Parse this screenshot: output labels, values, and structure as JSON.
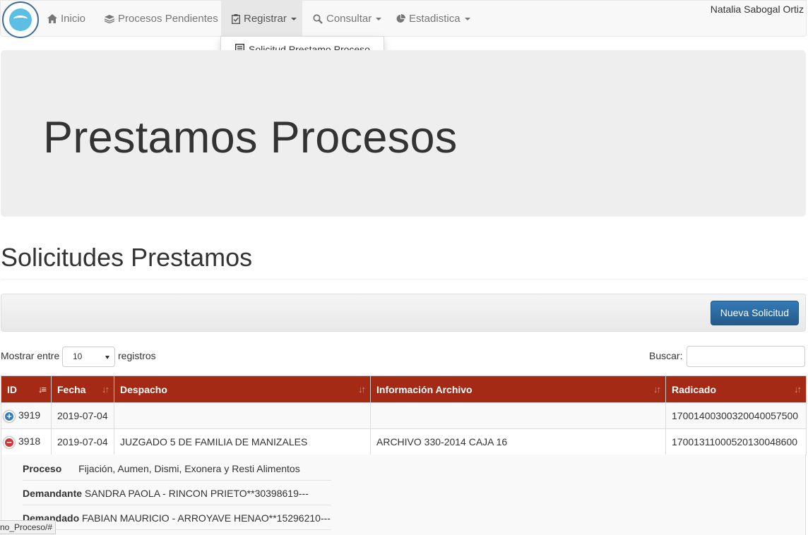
{
  "nav": {
    "items": [
      {
        "label": "Inicio",
        "icon": "home-icon"
      },
      {
        "label": "Procesos Pendientes",
        "icon": "layers-icon"
      },
      {
        "label": "Registrar",
        "icon": "clipboard-check-icon"
      },
      {
        "label": "Consultar",
        "icon": "search-icon"
      },
      {
        "label": "Estadistica",
        "icon": "pie-chart-icon"
      }
    ],
    "user": "Natalia Sabogal Ortiz"
  },
  "dropdown": {
    "items": [
      {
        "label": "Solicitud Prestamo Proceso",
        "icon": "list-alt-icon"
      }
    ]
  },
  "jumbotron": {
    "title": "Prestamos Procesos"
  },
  "section": {
    "title": "Solicitudes Prestamos"
  },
  "panel": {
    "new_button": "Nueva Solicitud"
  },
  "controls": {
    "show_before": "Mostrar entre",
    "show_value": "10",
    "show_after": "registros",
    "search_label": "Buscar:",
    "search_value": ""
  },
  "table": {
    "columns": [
      "ID",
      "Fecha",
      "Despacho",
      "Información Archivo",
      "Radicado"
    ],
    "rows": [
      {
        "id": "3919",
        "fecha": "2019-07-04",
        "despacho": "",
        "info": "",
        "radicado": "17001400300320040057500",
        "expanded": false
      },
      {
        "id": "3918",
        "fecha": "2019-07-04",
        "despacho": "JUZGADO 5 DE FAMILIA DE MANIZALES",
        "info": "ARCHIVO 330-2014 CAJA 16",
        "radicado": "17001311000520130048600",
        "expanded": true
      }
    ],
    "detail": [
      {
        "label": "Proceso",
        "value": "Fijación, Aumen, Dismi, Exonera y Resti Alimentos"
      },
      {
        "label": "Demandante",
        "value": "SANDRA PAOLA - RINCON PRIETO**30398619---"
      },
      {
        "label": "Demandado",
        "value": "FABIAN MAURICIO - ARROYAVE HENAO**15296210---"
      }
    ]
  },
  "status_url": "no_Proceso/#",
  "colors": {
    "header_red": "#a52a16",
    "primary_blue": "#337ab7",
    "jumbotron_gray": "#eeeeee"
  }
}
